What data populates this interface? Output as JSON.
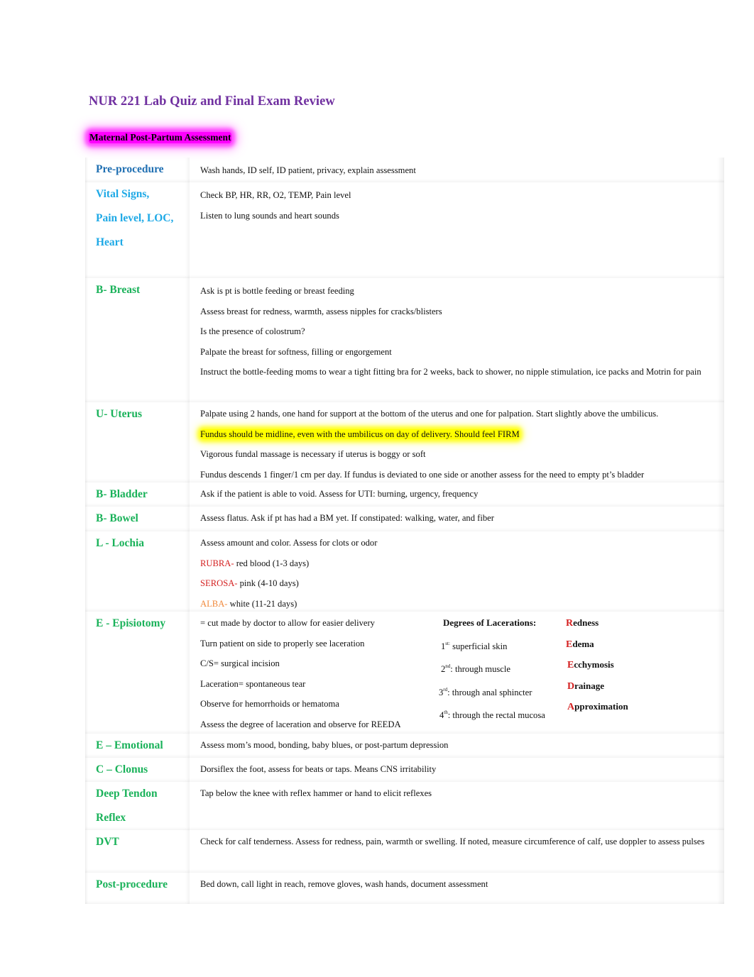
{
  "document": {
    "title": "NUR 221 Lab Quiz and Final Exam Review",
    "section_heading": "Maternal Post-Partum Assessment"
  },
  "colors": {
    "title": "#7030a0",
    "heading_highlight": "#ff00ff",
    "text_highlight": "#ffff00",
    "label_dark_blue": "#1f6fb2",
    "label_light_blue": "#1ea9e6",
    "label_green": "#1ab25a",
    "red": "#d42020",
    "orange": "#f0883a"
  },
  "rows": {
    "pre": {
      "label": [
        "Pre-procedure"
      ],
      "lines": [
        "Wash hands, ID self, ID patient, privacy, explain assessment"
      ]
    },
    "vitals": {
      "label": [
        "Vital Signs,",
        "Pain level, LOC,",
        "Heart"
      ],
      "lines": [
        "Check BP, HR, RR, O2, TEMP, Pain level",
        "Listen to lung sounds and heart sounds"
      ]
    },
    "breast": {
      "label": [
        "B- Breast"
      ],
      "lines": [
        "Ask is pt is bottle feeding or breast feeding",
        "Assess breast for redness, warmth, assess nipples for cracks/blisters",
        "Is the presence of colostrum?",
        "Palpate the breast for softness, filling or engorgement",
        "Instruct the bottle-feeding moms to wear a tight fitting bra for 2 weeks, back to shower, no nipple stimulation, ice packs and Motrin for pain"
      ]
    },
    "uterus": {
      "label": [
        "U- Uterus"
      ],
      "lines": [
        "Palpate using 2 hands, one hand for support at the bottom of the uterus and one for palpation. Start slightly above the umbilicus.",
        "Fundus should be midline, even with the umbilicus on day of delivery. Should feel FIRM",
        "Vigorous fundal massage is necessary if uterus is boggy or soft",
        "Fundus descends 1 finger/1 cm per day. If fundus is deviated to one side or another assess for the need to empty pt’s bladder"
      ]
    },
    "bladder": {
      "label": [
        "B- Bladder"
      ],
      "lines": [
        "Ask if the patient is able to void. Assess for UTI: burning, urgency, frequency"
      ]
    },
    "bowel": {
      "label": [
        "B- Bowel"
      ],
      "lines": [
        "Assess flatus. Ask if pt has had a BM yet. If constipated: walking, water, and fiber"
      ]
    },
    "lochia": {
      "label": [
        "L - Lochia"
      ],
      "lines": [
        "Assess amount and color. Assess for clots or odor"
      ],
      "types": [
        {
          "key": "RUBRA-",
          "desc": " red blood (1-3 days)"
        },
        {
          "key": "SEROSA-",
          "desc": " pink (4-10 days)"
        },
        {
          "key": "ALBA-",
          "desc": " white (11-21 days)"
        }
      ]
    },
    "episiotomy": {
      "label": [
        "E - Episiotomy"
      ],
      "lines": [
        "= cut made by doctor to allow for easier delivery",
        "Turn patient on side to properly see laceration",
        "C/S= surgical incision",
        "Laceration= spontaneous tear",
        "Observe for hemorrhoids or hematoma",
        "Assess the degree of laceration and observe for REEDA"
      ],
      "degrees_heading": "Degrees of Lacerations:",
      "degrees": [
        {
          "num": "1",
          "sup": "st:",
          "desc": " superficial skin"
        },
        {
          "num": "2",
          "sup": "nd",
          "desc": ": through muscle"
        },
        {
          "num": "3",
          "sup": "rd",
          "desc": ": through anal sphincter"
        },
        {
          "num": "4",
          "sup": "th",
          "desc": ": through the rectal mucosa"
        }
      ],
      "reeda": [
        {
          "letter": "R",
          "rest": "edness"
        },
        {
          "letter": "E",
          "rest": "dema"
        },
        {
          "letter": "E",
          "rest": "cchymosis"
        },
        {
          "letter": "D",
          "rest": "rainage"
        },
        {
          "letter": "A",
          "rest": "pproximation"
        }
      ]
    },
    "emotional": {
      "label": [
        "E – Emotional"
      ],
      "lines": [
        "Assess mom’s mood, bonding, baby blues, or post-partum depression"
      ]
    },
    "clonus": {
      "label": [
        "C – Clonus"
      ],
      "lines": [
        "Dorsiflex the foot, assess for beats or taps. Means CNS irritability"
      ]
    },
    "dtr": {
      "label": [
        "Deep Tendon",
        "Reflex"
      ],
      "lines": [
        "Tap below the knee with reflex hammer or hand to elicit reflexes"
      ]
    },
    "dvt": {
      "label": [
        "DVT"
      ],
      "lines": [
        "Check for calf tenderness. Assess for redness, pain, warmth or swelling. If noted, measure circumference of calf, use doppler to assess pulses"
      ]
    },
    "post": {
      "label": [
        "Post-procedure"
      ],
      "lines": [
        "Bed down, call light in reach, remove gloves, wash hands, document assessment"
      ]
    }
  }
}
